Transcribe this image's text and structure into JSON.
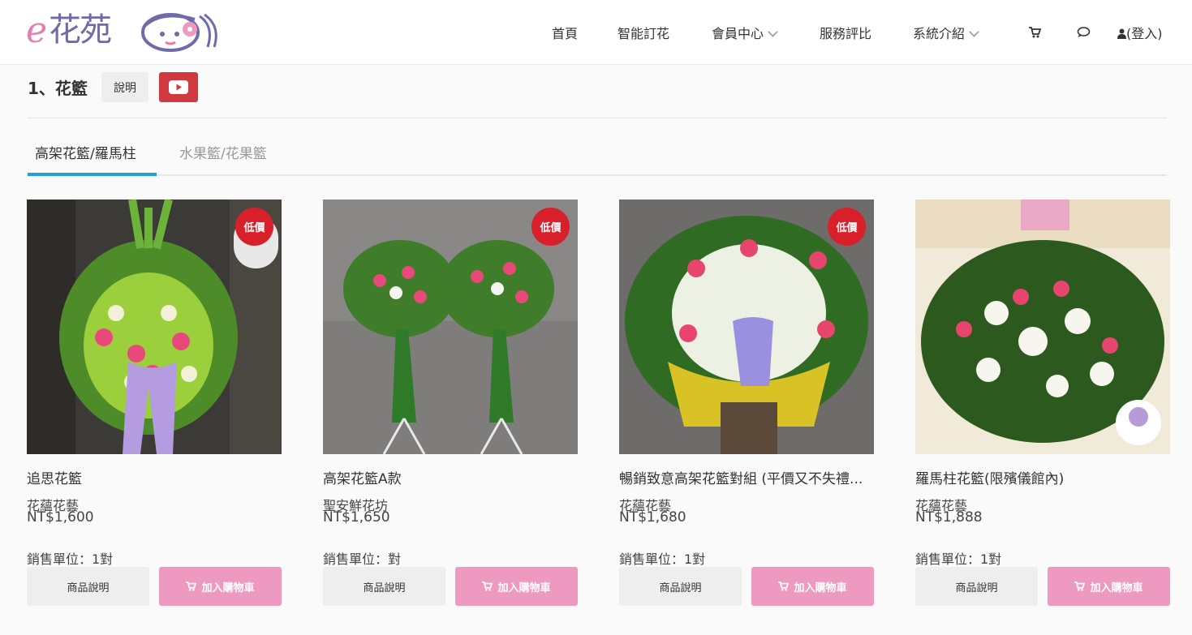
{
  "brand": {
    "logo_e": "e",
    "logo_text": "花苑"
  },
  "nav": {
    "home": "首頁",
    "smart_order": "智能訂花",
    "member_center": "會員中心",
    "service_compare": "服務評比",
    "system_intro": "系統介紹",
    "cart_icon": "shopping-cart-icon",
    "chat_icon": "chat-bubble-icon",
    "user_icon": "user-icon",
    "login": "(登入)"
  },
  "section": {
    "title": "1、花籃",
    "desc_button": "說明",
    "video_icon": "youtube-play-icon",
    "video_color": "#d0393e"
  },
  "tabs": [
    {
      "label": "高架花籃/羅馬柱",
      "active": true
    },
    {
      "label": "水果籃/花果籃",
      "active": false
    }
  ],
  "colors": {
    "tab_accent": "#1ba3d8",
    "cart_button": "#ee9ac0",
    "badge": "#d8202a"
  },
  "products": [
    {
      "name": "追思花籃",
      "shop": "花蘊花藝",
      "price": "NT$1,600",
      "unit": "銷售單位：1對",
      "badge": "低價",
      "desc_button": "商品說明",
      "cart_button": "加入購物車"
    },
    {
      "name": "高架花籃A款",
      "shop": "聖安鮮花坊",
      "price": "NT$1,650",
      "unit": "銷售單位：對",
      "badge": "低價",
      "desc_button": "商品說明",
      "cart_button": "加入購物車"
    },
    {
      "name": "暢銷致意高架花籃對組 (平價又不失禮...",
      "shop": "花蘊花藝",
      "price": "NT$1,680",
      "unit": "銷售單位：1對",
      "badge": "低價",
      "desc_button": "商品說明",
      "cart_button": "加入購物車"
    },
    {
      "name": "羅馬柱花籃(限殯儀館內)",
      "shop": "花蘊花藝",
      "price": "NT$1,888",
      "unit": "銷售單位：1對",
      "badge": "",
      "desc_button": "商品說明",
      "cart_button": "加入購物車"
    }
  ]
}
